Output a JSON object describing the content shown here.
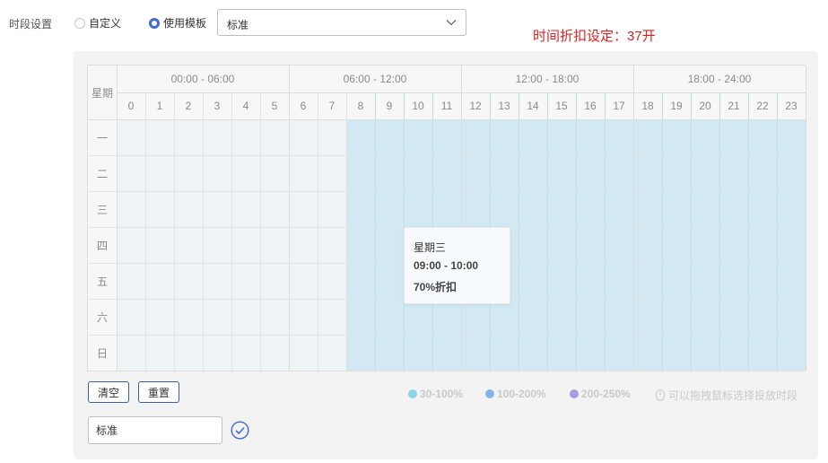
{
  "header": {
    "label": "时段设置",
    "radio_custom": "自定义",
    "radio_template": "使用模板",
    "selected_mode": "template",
    "template_value": "标准",
    "discount_text": "时间折扣设定：37开"
  },
  "schedule": {
    "corner_label": "星期",
    "hour_groups": [
      "00:00 - 06:00",
      "06:00 - 12:00",
      "12:00 - 18:00",
      "18:00 - 24:00"
    ],
    "hours": [
      "0",
      "1",
      "2",
      "3",
      "4",
      "5",
      "6",
      "7",
      "8",
      "9",
      "10",
      "11",
      "12",
      "13",
      "14",
      "15",
      "16",
      "17",
      "18",
      "19",
      "20",
      "21",
      "22",
      "23"
    ],
    "days": [
      "一",
      "二",
      "三",
      "四",
      "五",
      "六",
      "日"
    ],
    "selected_start_hour": 8,
    "selected_end_hour": 24,
    "tooltip": {
      "day": "星期三",
      "time": "09:00 - 10:00",
      "discount": "70%折扣"
    }
  },
  "actions": {
    "clear_label": "清空",
    "reset_label": "重置"
  },
  "legend": {
    "items": [
      {
        "label": "30-100%",
        "color": "#8ed3ee"
      },
      {
        "label": "100-200%",
        "color": "#7fb5ea"
      },
      {
        "label": "200-250%",
        "color": "#a99be3"
      }
    ],
    "hint": "可以拖拽鼠标选择投放时段"
  },
  "template_name": {
    "value": "标准"
  },
  "colors": {
    "selected_cell": "#d2e9f4",
    "unselected_cell": "#eef3f6",
    "discount_text": "#e02020",
    "accent": "#3f6ad8"
  }
}
